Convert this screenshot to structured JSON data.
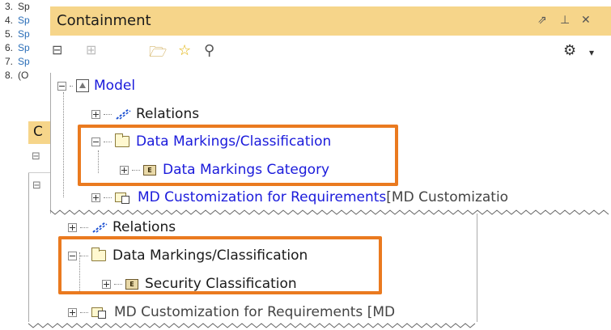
{
  "doc_list": [
    {
      "num": "3.",
      "text": "Sp"
    },
    {
      "num": "4.",
      "text": "Sp"
    },
    {
      "num": "5.",
      "text": "Sp"
    },
    {
      "num": "6.",
      "text": "Sp"
    },
    {
      "num": "7.",
      "text": "Sp"
    },
    {
      "num": "8.",
      "text": "(O"
    }
  ],
  "top_panel": {
    "title": "Containment",
    "tree": {
      "model": "Model",
      "relations": "Relations",
      "folder": "Data Markings/Classification",
      "category": "Data Markings Category",
      "customization": "MD Customization for Requirements",
      "customization_suffix": " [MD Customizatio"
    }
  },
  "bottom_panel": {
    "title": "C",
    "tree": {
      "relations": "Relations",
      "folder": "Data Markings/Classification",
      "security": "Security Classification",
      "customization": "MD Customization for Requirements [MD"
    }
  },
  "colors": {
    "titlebar": "#f6d58a",
    "highlight": "#ea7a1f",
    "link": "#1a1adb"
  }
}
